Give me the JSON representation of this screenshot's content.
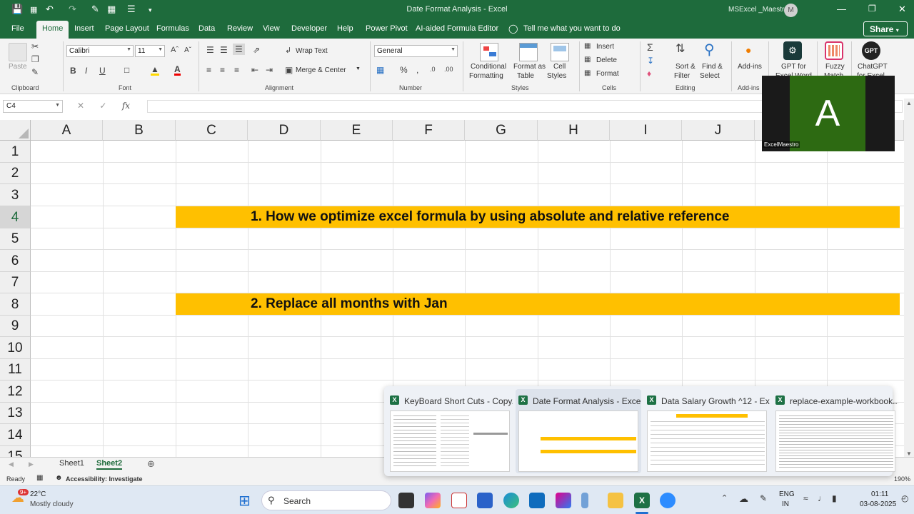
{
  "titlebar": {
    "title": "Date Format Analysis  -  Excel",
    "account": "MSExcel _Maestro",
    "avatar_initial": "M"
  },
  "tabs": [
    "File",
    "Home",
    "Insert",
    "Page Layout",
    "Formulas",
    "Data",
    "Review",
    "View",
    "Developer",
    "Help",
    "Power Pivot",
    "AI-aided Formula Editor"
  ],
  "active_tab": "Home",
  "tell_me": "Tell me what you want to do",
  "share_label": "Share",
  "ribbon": {
    "clipboard": {
      "paste": "Paste",
      "label": "Clipboard"
    },
    "font": {
      "name": "Calibri",
      "size": "11",
      "label": "Font"
    },
    "alignment": {
      "wrap": "Wrap Text",
      "merge": "Merge & Center",
      "label": "Alignment"
    },
    "number": {
      "format": "General",
      "label": "Number"
    },
    "styles": {
      "cond1": "Conditional",
      "cond2": "Formatting",
      "fmt1": "Format as",
      "fmt2": "Table",
      "cell1": "Cell",
      "cell2": "Styles",
      "label": "Styles"
    },
    "cells": {
      "insert": "Insert",
      "delete": "Delete",
      "format": "Format",
      "label": "Cells"
    },
    "editing": {
      "sort1": "Sort &",
      "sort2": "Filter",
      "find1": "Find &",
      "find2": "Select",
      "label": "Editing"
    },
    "addins": {
      "addins": "Add-ins",
      "label": "Add-ins",
      "gpt1": "GPT for",
      "gpt2": "Excel Word",
      "fuzzy1": "Fuzzy",
      "fuzzy2": "Match",
      "chatgpt1": "ChatGPT",
      "chatgpt2": "for Excel",
      "chatgpt_badge": "GPT"
    }
  },
  "formula_bar": {
    "name_box": "C4",
    "fx": "fx",
    "content": ""
  },
  "columns": [
    "A",
    "B",
    "C",
    "D",
    "E",
    "F",
    "G",
    "H",
    "I",
    "J"
  ],
  "rows": [
    "1",
    "2",
    "3",
    "4",
    "5",
    "6",
    "7",
    "8",
    "9",
    "10",
    "11",
    "12",
    "13",
    "14",
    "15"
  ],
  "cells": {
    "c4": "1. How we optimize excel formula by using absolute and relative reference",
    "c8": "2. Replace all months with Jan"
  },
  "sheets": [
    "Sheet1",
    "Sheet2"
  ],
  "active_sheet": "Sheet2",
  "status": {
    "ready": "Ready",
    "accessibility": "Accessibility: Investigate",
    "zoom": "190%"
  },
  "webcam": {
    "initial": "A",
    "name": "ExcelMaestro"
  },
  "previews": [
    "KeyBoard Short Cuts - Copy...",
    "Date Format Analysis - Excel",
    "Data Salary Growth ^12 - Ex...",
    "replace-example-workbook..."
  ],
  "taskbar": {
    "weather_temp": "22°C",
    "weather_desc": "Mostly cloudy",
    "weather_badge": "9+",
    "search": "Search",
    "lang1": "ENG",
    "lang2": "IN",
    "time": "01:11",
    "date": "03-08-2025"
  },
  "colors": {
    "excel_green": "#1e6b3c",
    "banner": "#ffc000",
    "webcam_bg": "#2d6a12"
  }
}
